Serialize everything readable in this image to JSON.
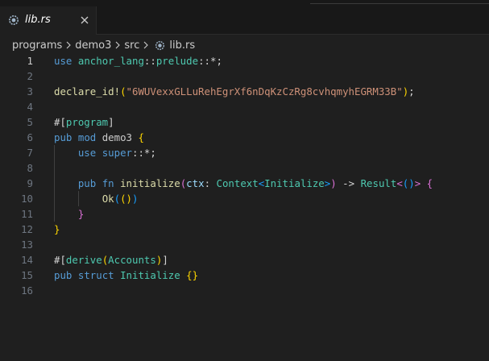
{
  "tab": {
    "label": "lib.rs",
    "close_glyph": "×"
  },
  "breadcrumb": {
    "items": [
      "programs",
      "demo3",
      "src",
      "lib.rs"
    ]
  },
  "editor": {
    "active_line": 1,
    "lines": [
      {
        "n": "1",
        "tokens": [
          [
            "kw",
            "use"
          ],
          [
            "plain",
            " "
          ],
          [
            "ns",
            "anchor_lang"
          ],
          [
            "punc",
            "::"
          ],
          [
            "ns",
            "prelude"
          ],
          [
            "punc",
            "::*;"
          ]
        ]
      },
      {
        "n": "2",
        "tokens": []
      },
      {
        "n": "3",
        "tokens": [
          [
            "fn",
            "declare_id!"
          ],
          [
            "b1",
            "("
          ],
          [
            "str",
            "\"6WUVexxGLLuRehEgrXf6nDqKzCzRg8cvhqmyhEGRM33B\""
          ],
          [
            "b1",
            ")"
          ],
          [
            "punc",
            ";"
          ]
        ]
      },
      {
        "n": "4",
        "tokens": []
      },
      {
        "n": "5",
        "tokens": [
          [
            "attr",
            "#["
          ],
          [
            "ns",
            "program"
          ],
          [
            "attr",
            "]"
          ]
        ]
      },
      {
        "n": "6",
        "tokens": [
          [
            "kw",
            "pub"
          ],
          [
            "plain",
            " "
          ],
          [
            "kw",
            "mod"
          ],
          [
            "plain",
            " demo3 "
          ],
          [
            "b1",
            "{"
          ]
        ]
      },
      {
        "n": "7",
        "tokens": [
          [
            "plain",
            "    "
          ],
          [
            "kw",
            "use"
          ],
          [
            "plain",
            " "
          ],
          [
            "kw",
            "super"
          ],
          [
            "punc",
            "::*;"
          ]
        ]
      },
      {
        "n": "8",
        "tokens": []
      },
      {
        "n": "9",
        "tokens": [
          [
            "plain",
            "    "
          ],
          [
            "kw",
            "pub"
          ],
          [
            "plain",
            " "
          ],
          [
            "kw",
            "fn"
          ],
          [
            "plain",
            " "
          ],
          [
            "fn",
            "initialize"
          ],
          [
            "b2",
            "("
          ],
          [
            "var",
            "ctx"
          ],
          [
            "punc",
            ": "
          ],
          [
            "typ",
            "Context"
          ],
          [
            "b3",
            "<"
          ],
          [
            "typ",
            "Initialize"
          ],
          [
            "b3",
            ">"
          ],
          [
            "b2",
            ")"
          ],
          [
            "punc",
            " -> "
          ],
          [
            "typ",
            "Result"
          ],
          [
            "b2",
            "<"
          ],
          [
            "b3",
            "()"
          ],
          [
            "b2",
            ">"
          ],
          [
            "plain",
            " "
          ],
          [
            "b2",
            "{"
          ]
        ]
      },
      {
        "n": "10",
        "tokens": [
          [
            "plain",
            "        "
          ],
          [
            "fn",
            "Ok"
          ],
          [
            "b3",
            "("
          ],
          [
            "b1",
            "()"
          ],
          [
            "b3",
            ")"
          ]
        ]
      },
      {
        "n": "11",
        "tokens": [
          [
            "plain",
            "    "
          ],
          [
            "b2",
            "}"
          ]
        ]
      },
      {
        "n": "12",
        "tokens": [
          [
            "b1",
            "}"
          ]
        ]
      },
      {
        "n": "13",
        "tokens": []
      },
      {
        "n": "14",
        "tokens": [
          [
            "attr",
            "#["
          ],
          [
            "ns",
            "derive"
          ],
          [
            "b1",
            "("
          ],
          [
            "typ",
            "Accounts"
          ],
          [
            "b1",
            ")"
          ],
          [
            "attr",
            "]"
          ]
        ]
      },
      {
        "n": "15",
        "tokens": [
          [
            "kw",
            "pub"
          ],
          [
            "plain",
            " "
          ],
          [
            "kw",
            "struct"
          ],
          [
            "plain",
            " "
          ],
          [
            "typ",
            "Initialize"
          ],
          [
            "plain",
            " "
          ],
          [
            "b1",
            "{}"
          ]
        ]
      },
      {
        "n": "16",
        "tokens": []
      }
    ]
  }
}
